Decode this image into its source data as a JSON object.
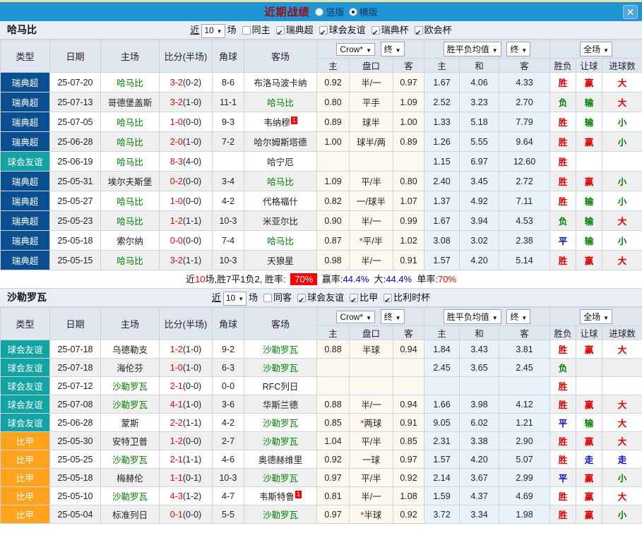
{
  "titlebar": {
    "title": "近期战绩",
    "radio_vertical": "竖版",
    "radio_horizontal": "横版",
    "close": "✕"
  },
  "columns": {
    "type": "类型",
    "date": "日期",
    "home": "主场",
    "score": "比分(半场)",
    "corner": "角球",
    "away": "客场",
    "sub": [
      "主",
      "盘口",
      "客",
      "主",
      "和",
      "客",
      "胜负",
      "让球",
      "进球数"
    ],
    "select_crow": "Crow*",
    "select_final1": "终",
    "select_avg": "胜平负均值",
    "select_final2": "终",
    "select_full": "全场"
  },
  "league_colors": {
    "瑞典超": "#0a4f92",
    "球会友谊": "#12a3a3",
    "比甲": "#ffa31c"
  },
  "sections": [
    {
      "team": "哈马比",
      "filter": {
        "near": "近",
        "count": "10",
        "unit": "场",
        "same_label": "同主",
        "same_checked": false,
        "leagues": [
          "瑞典超",
          "球会友谊",
          "瑞典杯",
          "欧会杯"
        ]
      },
      "rows": [
        {
          "league": "瑞典超",
          "date": "25-07-20",
          "home": "哈马比",
          "hg": 1,
          "score": "3-2",
          "half": "(0-2)",
          "corner": "8-6",
          "away": "布洛马波卡纳",
          "ag": 0,
          "badge": "",
          "oh": "0.92",
          "hc": "半/一",
          "star": 0,
          "oa": "0.97",
          "ah": "1.67",
          "ad": "4.06",
          "aa": "4.33",
          "rw": "胜",
          "rh": "赢",
          "rg": "大"
        },
        {
          "league": "瑞典超",
          "date": "25-07-13",
          "home": "哥德堡盖斯",
          "hg": 0,
          "score": "3-2",
          "half": "(1-0)",
          "corner": "11-1",
          "away": "哈马比",
          "ag": 1,
          "badge": "",
          "oh": "0.80",
          "hc": "平手",
          "star": 0,
          "oa": "1.09",
          "ah": "2.52",
          "ad": "3.23",
          "aa": "2.70",
          "rw": "负",
          "rh": "输",
          "rg": "大"
        },
        {
          "league": "瑞典超",
          "date": "25-07-05",
          "home": "哈马比",
          "hg": 1,
          "score": "1-0",
          "half": "(0-0)",
          "corner": "9-3",
          "away": "韦纳穆",
          "ag": 0,
          "badge": "1",
          "oh": "0.89",
          "hc": "球半",
          "star": 0,
          "oa": "1.00",
          "ah": "1.33",
          "ad": "5.18",
          "aa": "7.79",
          "rw": "胜",
          "rh": "输",
          "rg": "小"
        },
        {
          "league": "瑞典超",
          "date": "25-06-28",
          "home": "哈马比",
          "hg": 1,
          "score": "2-0",
          "half": "(1-0)",
          "corner": "7-2",
          "away": "哈尔姆斯塔德",
          "ag": 0,
          "badge": "",
          "oh": "1.00",
          "hc": "球半/两",
          "star": 0,
          "oa": "0.89",
          "ah": "1.26",
          "ad": "5.55",
          "aa": "9.64",
          "rw": "胜",
          "rh": "赢",
          "rg": "小"
        },
        {
          "league": "球会友谊",
          "date": "25-06-19",
          "home": "哈马比",
          "hg": 1,
          "score": "8-3",
          "half": "(4-0)",
          "corner": "",
          "away": "哈宁厄",
          "ag": 0,
          "badge": "",
          "oh": "",
          "hc": "",
          "star": 0,
          "oa": "",
          "ah": "1.15",
          "ad": "6.97",
          "aa": "12.60",
          "rw": "胜",
          "rh": "",
          "rg": ""
        },
        {
          "league": "瑞典超",
          "date": "25-05-31",
          "home": "埃尔夫斯堡",
          "hg": 0,
          "score": "0-2",
          "half": "(0-0)",
          "corner": "3-4",
          "away": "哈马比",
          "ag": 1,
          "badge": "",
          "oh": "1.09",
          "hc": "平/半",
          "star": 0,
          "oa": "0.80",
          "ah": "2.40",
          "ad": "3.45",
          "aa": "2.72",
          "rw": "胜",
          "rh": "赢",
          "rg": "小"
        },
        {
          "league": "瑞典超",
          "date": "25-05-27",
          "home": "哈马比",
          "hg": 1,
          "score": "1-0",
          "half": "(0-0)",
          "corner": "4-2",
          "away": "代格福什",
          "ag": 0,
          "badge": "",
          "oh": "0.82",
          "hc": "一/球半",
          "star": 0,
          "oa": "1.07",
          "ah": "1.37",
          "ad": "4.92",
          "aa": "7.11",
          "rw": "胜",
          "rh": "输",
          "rg": "小"
        },
        {
          "league": "瑞典超",
          "date": "25-05-23",
          "home": "哈马比",
          "hg": 1,
          "score": "1-2",
          "half": "(1-1)",
          "corner": "10-3",
          "away": "米亚尔比",
          "ag": 0,
          "badge": "",
          "oh": "0.90",
          "hc": "半/一",
          "star": 0,
          "oa": "0.99",
          "ah": "1.67",
          "ad": "3.94",
          "aa": "4.53",
          "rw": "负",
          "rh": "输",
          "rg": "大"
        },
        {
          "league": "瑞典超",
          "date": "25-05-18",
          "home": "索尔纳",
          "hg": 0,
          "score": "0-0",
          "half": "(0-0)",
          "corner": "7-4",
          "away": "哈马比",
          "ag": 1,
          "badge": "",
          "oh": "0.87",
          "hc": "平/半",
          "star": 1,
          "oa": "1.02",
          "ah": "3.08",
          "ad": "3.02",
          "aa": "2.38",
          "rw": "平",
          "rh": "输",
          "rg": "小"
        },
        {
          "league": "瑞典超",
          "date": "25-05-15",
          "home": "哈马比",
          "hg": 1,
          "score": "3-2",
          "half": "(1-1)",
          "corner": "10-3",
          "away": "天狼星",
          "ag": 0,
          "badge": "",
          "oh": "0.98",
          "hc": "半/一",
          "star": 0,
          "oa": "0.91",
          "ah": "1.57",
          "ad": "4.20",
          "aa": "5.14",
          "rw": "胜",
          "rh": "赢",
          "rg": "大"
        }
      ],
      "summary": {
        "prefix": "近",
        "count": "10",
        "mid": "场,胜7平1负2, 胜率:",
        "win_rate": "70%",
        "label_win": "赢率:",
        "val_win": "44.4%",
        "label_big": "大:",
        "val_big": "44.4%",
        "label_single": "单率:",
        "val_single": "70%"
      }
    },
    {
      "team": "沙勒罗瓦",
      "filter": {
        "near": "近",
        "count": "10",
        "unit": "场",
        "same_label": "同客",
        "same_checked": false,
        "leagues": [
          "球会友谊",
          "比甲",
          "比利时杯"
        ]
      },
      "rows": [
        {
          "league": "球会友谊",
          "date": "25-07-18",
          "home": "乌德勒支",
          "hg": 0,
          "score": "1-2",
          "half": "(1-0)",
          "corner": "9-2",
          "away": "沙勒罗瓦",
          "ag": 1,
          "badge": "",
          "oh": "0.88",
          "hc": "半球",
          "star": 0,
          "oa": "0.94",
          "ah": "1.84",
          "ad": "3.43",
          "aa": "3.81",
          "rw": "胜",
          "rh": "赢",
          "rg": "大"
        },
        {
          "league": "球会友谊",
          "date": "25-07-18",
          "home": "海伦芬",
          "hg": 0,
          "score": "1-0",
          "half": "(1-0)",
          "corner": "6-3",
          "away": "沙勒罗瓦",
          "ag": 1,
          "badge": "",
          "oh": "",
          "hc": "",
          "star": 0,
          "oa": "",
          "ah": "2.45",
          "ad": "3.65",
          "aa": "2.45",
          "rw": "负",
          "rh": "",
          "rg": ""
        },
        {
          "league": "球会友谊",
          "date": "25-07-12",
          "home": "沙勒罗瓦",
          "hg": 1,
          "score": "2-1",
          "half": "(0-0)",
          "corner": "0-0",
          "away": "RFC列日",
          "ag": 0,
          "badge": "",
          "oh": "",
          "hc": "",
          "star": 0,
          "oa": "",
          "ah": "",
          "ad": "",
          "aa": "",
          "rw": "胜",
          "rh": "",
          "rg": ""
        },
        {
          "league": "球会友谊",
          "date": "25-07-08",
          "home": "沙勒罗瓦",
          "hg": 1,
          "score": "4-1",
          "half": "(1-0)",
          "corner": "3-6",
          "away": "华斯兰德",
          "ag": 0,
          "badge": "",
          "oh": "0.88",
          "hc": "半/一",
          "star": 0,
          "oa": "0.94",
          "ah": "1.66",
          "ad": "3.98",
          "aa": "4.12",
          "rw": "胜",
          "rh": "赢",
          "rg": "大"
        },
        {
          "league": "球会友谊",
          "date": "25-06-28",
          "home": "蒙斯",
          "hg": 0,
          "score": "2-2",
          "half": "(1-1)",
          "corner": "4-2",
          "away": "沙勒罗瓦",
          "ag": 1,
          "badge": "",
          "oh": "0.85",
          "hc": "两球",
          "star": 1,
          "oa": "0.91",
          "ah": "9.05",
          "ad": "6.02",
          "aa": "1.21",
          "rw": "平",
          "rh": "输",
          "rg": "大"
        },
        {
          "league": "比甲",
          "date": "25-05-30",
          "home": "安特卫普",
          "hg": 0,
          "score": "1-2",
          "half": "(0-0)",
          "corner": "2-7",
          "away": "沙勒罗瓦",
          "ag": 1,
          "badge": "",
          "oh": "1.04",
          "hc": "平/半",
          "star": 0,
          "oa": "0.85",
          "ah": "2.31",
          "ad": "3.38",
          "aa": "2.90",
          "rw": "胜",
          "rh": "赢",
          "rg": "大"
        },
        {
          "league": "比甲",
          "date": "25-05-25",
          "home": "沙勒罗瓦",
          "hg": 1,
          "score": "2-1",
          "half": "(1-1)",
          "corner": "4-6",
          "away": "奥德赫维里",
          "ag": 0,
          "badge": "",
          "oh": "0.92",
          "hc": "一球",
          "star": 0,
          "oa": "0.97",
          "ah": "1.57",
          "ad": "4.20",
          "aa": "5.07",
          "rw": "胜",
          "rh": "走",
          "rg": "走"
        },
        {
          "league": "比甲",
          "date": "25-05-18",
          "home": "梅赫伦",
          "hg": 0,
          "score": "1-1",
          "half": "(0-1)",
          "corner": "10-3",
          "away": "沙勒罗瓦",
          "ag": 1,
          "badge": "",
          "oh": "0.97",
          "hc": "平/半",
          "star": 0,
          "oa": "0.92",
          "ah": "2.14",
          "ad": "3.67",
          "aa": "2.99",
          "rw": "平",
          "rh": "赢",
          "rg": "小"
        },
        {
          "league": "比甲",
          "date": "25-05-10",
          "home": "沙勒罗瓦",
          "hg": 1,
          "score": "4-3",
          "half": "(1-2)",
          "corner": "4-7",
          "away": "韦斯特鲁",
          "ag": 0,
          "badge": "1",
          "oh": "0.81",
          "hc": "半/一",
          "star": 0,
          "oa": "1.08",
          "ah": "1.59",
          "ad": "4.37",
          "aa": "4.69",
          "rw": "胜",
          "rh": "赢",
          "rg": "大"
        },
        {
          "league": "比甲",
          "date": "25-05-04",
          "home": "标准列日",
          "hg": 0,
          "score": "0-1",
          "half": "(0-0)",
          "corner": "5-5",
          "away": "沙勒罗瓦",
          "ag": 1,
          "badge": "",
          "oh": "0.97",
          "hc": "半球",
          "star": 1,
          "oa": "0.92",
          "ah": "3.72",
          "ad": "3.34",
          "aa": "1.98",
          "rw": "胜",
          "rh": "赢",
          "rg": "小"
        }
      ]
    }
  ]
}
